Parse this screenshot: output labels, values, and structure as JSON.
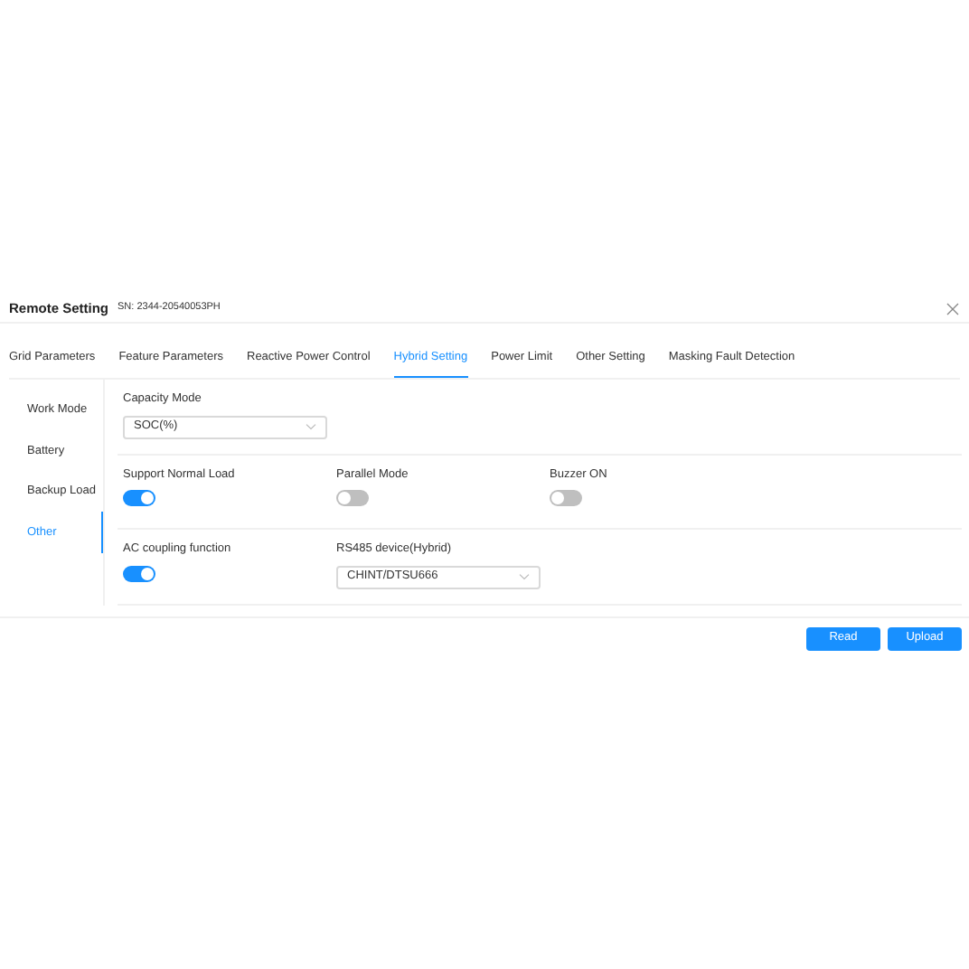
{
  "dialog": {
    "title": "Remote Setting",
    "serial": "SN:  2344-20540053PH"
  },
  "tabs": [
    {
      "label": "Grid Parameters",
      "selected": false
    },
    {
      "label": "Feature Parameters",
      "selected": false
    },
    {
      "label": "Reactive Power Control",
      "selected": false
    },
    {
      "label": "Hybrid Setting",
      "selected": true
    },
    {
      "label": "Power Limit",
      "selected": false
    },
    {
      "label": "Other Setting",
      "selected": false
    },
    {
      "label": "Masking Fault Detection",
      "selected": false
    }
  ],
  "sidebar": {
    "items": [
      {
        "label": "Work Mode",
        "selected": false
      },
      {
        "label": "Battery",
        "selected": false
      },
      {
        "label": "Backup Load",
        "selected": false
      },
      {
        "label": "Other",
        "selected": true
      }
    ]
  },
  "sections": [
    {
      "fields": [
        {
          "kind": "select",
          "label": "Capacity Mode",
          "value": "SOC(%)"
        }
      ]
    },
    {
      "fields": [
        {
          "kind": "switch",
          "label": "Support Normal Load",
          "on": true
        },
        {
          "kind": "switch",
          "label": "Parallel Mode",
          "on": false
        },
        {
          "kind": "switch",
          "label": "Buzzer ON",
          "on": false
        }
      ]
    },
    {
      "fields": [
        {
          "kind": "switch",
          "label": "AC coupling function",
          "on": true
        },
        {
          "kind": "select",
          "label": "RS485 device(Hybrid)",
          "value": "CHINT/DTSU666"
        }
      ]
    }
  ],
  "buttons": [
    "Read",
    "Upload"
  ]
}
